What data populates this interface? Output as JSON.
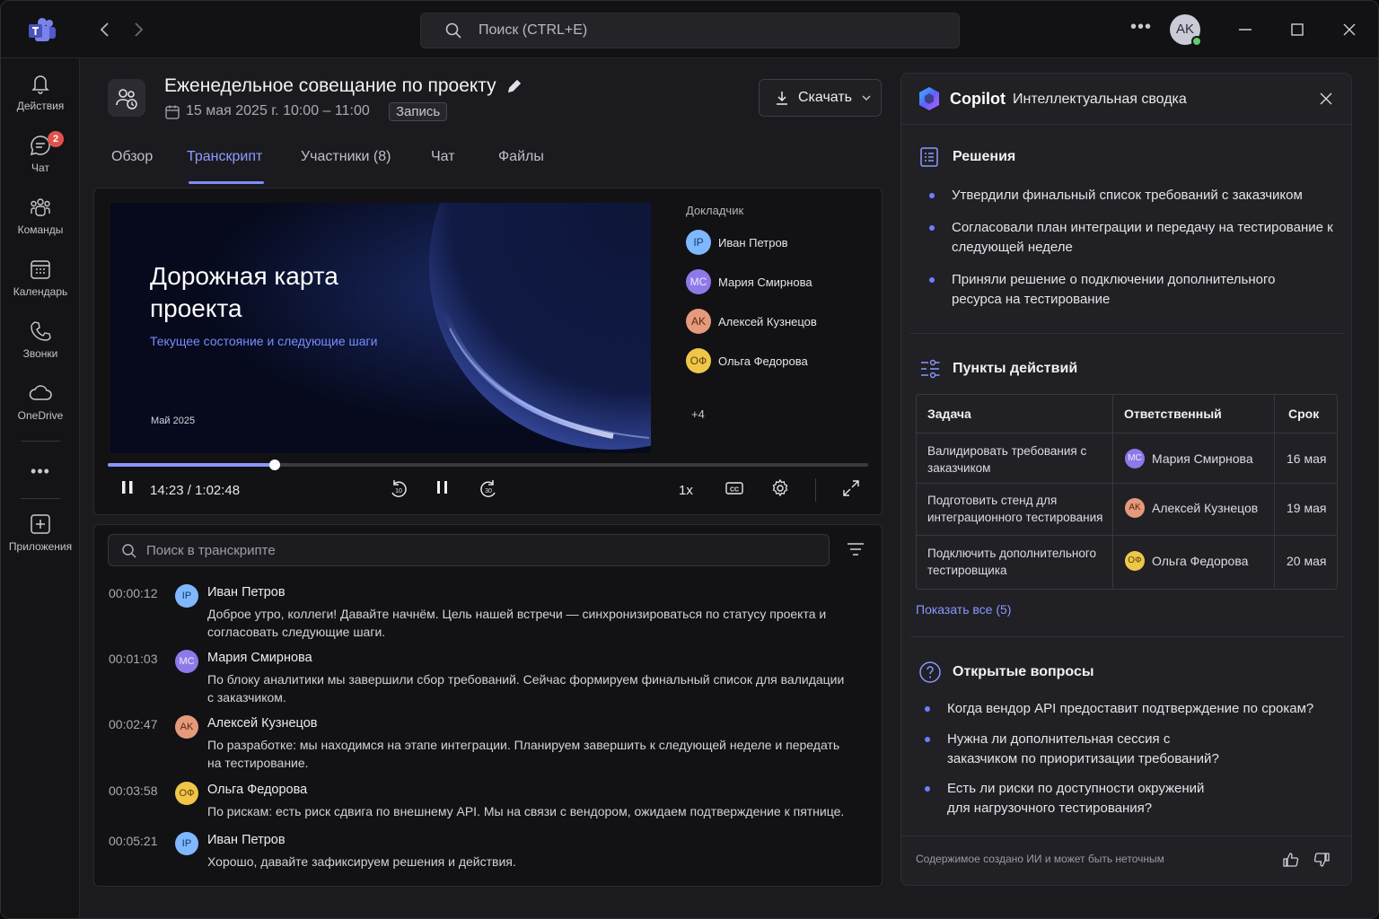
{
  "app": {
    "name": "Microsoft Teams"
  },
  "titlebar": {
    "search_placeholder": "Поиск (CTRL+E)",
    "user_initials": "AK",
    "presence_color": "#5fcf6b"
  },
  "rail": {
    "items": [
      {
        "label": "Действия",
        "icon": "bell-icon"
      },
      {
        "label": "Чат",
        "icon": "chat-icon",
        "badge": "2"
      },
      {
        "label": "Команды",
        "icon": "teams-icon"
      },
      {
        "label": "Календарь",
        "icon": "calendar-icon"
      },
      {
        "label": "Звонки",
        "icon": "phone-icon"
      },
      {
        "label": "OneDrive",
        "icon": "cloud-icon"
      },
      {
        "label": "Приложения",
        "icon": "add-app-icon"
      }
    ],
    "more": "•••"
  },
  "meeting": {
    "title": "Еженедельное совещание по проекту",
    "datetime": "15 мая 2025 г. 10:00 – 11:00",
    "badge": "Запись",
    "download_label": "Скачать"
  },
  "tabs": [
    {
      "label": "Обзор"
    },
    {
      "label": "Транскрипт",
      "active": true
    },
    {
      "label": "Участники (8)"
    },
    {
      "label": "Чат"
    },
    {
      "label": "Файлы"
    }
  ],
  "video": {
    "slide_title": "Дорожная карта проекта",
    "slide_subtitle": "Текущее состояние и следующие шаги",
    "slide_date": "Май 2025",
    "speakers_header": "Докладчик",
    "speakers": [
      {
        "initials": "IP",
        "name": "Иван Петров"
      },
      {
        "initials": "MC",
        "name": "Мария Смирнова"
      },
      {
        "initials": "AK",
        "name": "Алексей Кузнецов"
      },
      {
        "initials": "ОФ",
        "name": "Ольга Федорова"
      }
    ],
    "more_speakers": "+4",
    "current_time": "14:23",
    "time_sep": "/",
    "duration": "1:02:48",
    "progress": 0.22,
    "speed": "1x",
    "rewind_label": "10",
    "forward_label": "30"
  },
  "transcript": {
    "search_placeholder": "Поиск в транскрипте",
    "entries": [
      {
        "time": "00:00:12",
        "initials": "IP",
        "speaker": "Иван Петров",
        "text": "Доброе утро, коллеги! Давайте начнём. Цель нашей встречи — синхронизироваться по статусу проекта и согласовать следующие шаги."
      },
      {
        "time": "00:01:03",
        "initials": "MC",
        "speaker": "Мария Смирнова",
        "text": "По блоку аналитики мы завершили сбор требований. Сейчас формируем финальный список для валидации с заказчиком."
      },
      {
        "time": "00:02:47",
        "initials": "AK",
        "speaker": "Алексей Кузнецов",
        "text": "По разработке: мы находимся на этапе интеграции. Планируем завершить к следующей неделе и передать на тестирование."
      },
      {
        "time": "00:03:58",
        "initials": "ОФ",
        "speaker": "Ольга Федорова",
        "text": "По рискам: есть риск сдвига по внешнему API. Мы на связи с вендором, ожидаем подтверждение к пятнице."
      },
      {
        "time": "00:05:21",
        "initials": "IP",
        "speaker": "Иван Петров",
        "text": "Хорошо, давайте зафиксируем решения и действия."
      }
    ]
  },
  "copilot": {
    "name": "Copilot",
    "subtitle": "Интеллектуальная сводка",
    "decisions_title": "Решения",
    "decisions": [
      "Утвердили финальный список требований с заказчиком",
      "Согласовали план интеграции и передачу на тестирование к следующей неделе",
      "Приняли решение о подключении дополнительного ресурса на тестирование"
    ],
    "actions_title": "Пункты действий",
    "actions_headers": {
      "task": "Задача",
      "owner": "Ответственный",
      "due": "Срок"
    },
    "actions": [
      {
        "task": "Валидировать требования с заказчиком",
        "initials": "MC",
        "owner": "Мария Смирнова",
        "due": "16 мая"
      },
      {
        "task": "Подготовить стенд для интеграционного тестирования",
        "initials": "AK",
        "owner": "Алексей Кузнецов",
        "due": "19 мая"
      },
      {
        "task": "Подключить дополнительного тестировщика",
        "initials": "ОФ",
        "owner": "Ольга Федорова",
        "due": "20 мая"
      }
    ],
    "show_all": "Показать все (5)",
    "questions_title": "Открытые вопросы",
    "questions": [
      "Когда вендор API предоставит подтверждение по срокам?",
      "Нужна ли дополнительная сессия с заказчиком по приоритизации требований?",
      "Есть ли риски по доступности окружений для нагрузочного тестирования?"
    ],
    "footer": "Содержимое создано ИИ и может быть неточным"
  },
  "colors": {
    "accent": "#8a97ff",
    "badge_red": "#e0524d",
    "bg": "#1b1b1f"
  }
}
